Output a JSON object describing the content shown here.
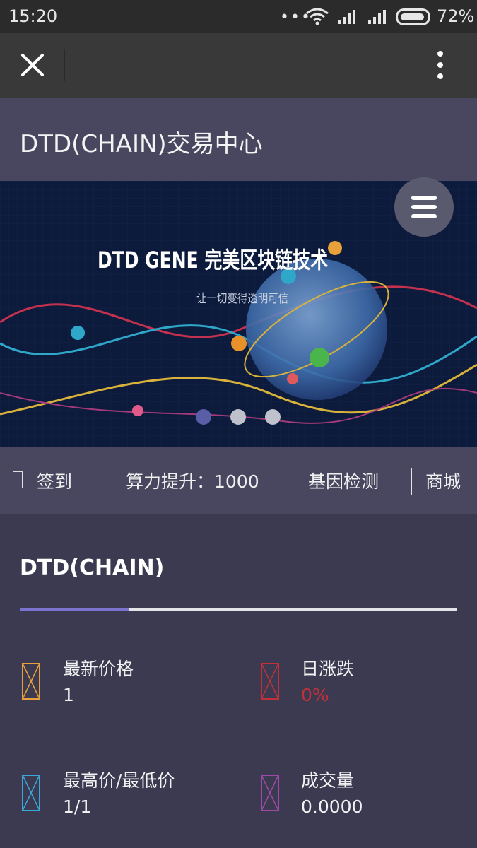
{
  "status_bar": {
    "time": "15:20",
    "battery": "72%"
  },
  "toolbar": {
    "close_icon": "close-icon",
    "more_icon": "more-vertical-icon"
  },
  "page_header": {
    "title": "DTD(CHAIN)交易中心"
  },
  "banner": {
    "headline": "DTD GENE 完美区块链技术",
    "subline": "让一切变得透明可信",
    "slides": 3,
    "active_slide": 1
  },
  "quick_nav": {
    "checkin": "签到",
    "hashrate": "算力提升：1000",
    "gene_test": "基因检测",
    "mall": "商城"
  },
  "market": {
    "title": "DTD(CHAIN)",
    "stats": [
      {
        "label": "最新价格",
        "value": "1",
        "color": "#e8a13a",
        "value_color": "#f2f2f2"
      },
      {
        "label": "日涨跌",
        "value": "0%",
        "color": "#c0313a",
        "value_color": "#c0313a"
      },
      {
        "label": "最高价/最低价",
        "value": "1/1",
        "color": "#3aa9d8",
        "value_color": "#f2f2f2"
      },
      {
        "label": "成交量",
        "value": "0.0000",
        "color": "#a04aa8",
        "value_color": "#f2f2f2"
      }
    ]
  },
  "colors": {
    "accent": "#7a74d0",
    "header_bg": "#48475f",
    "page_bg": "#3b3a51"
  }
}
